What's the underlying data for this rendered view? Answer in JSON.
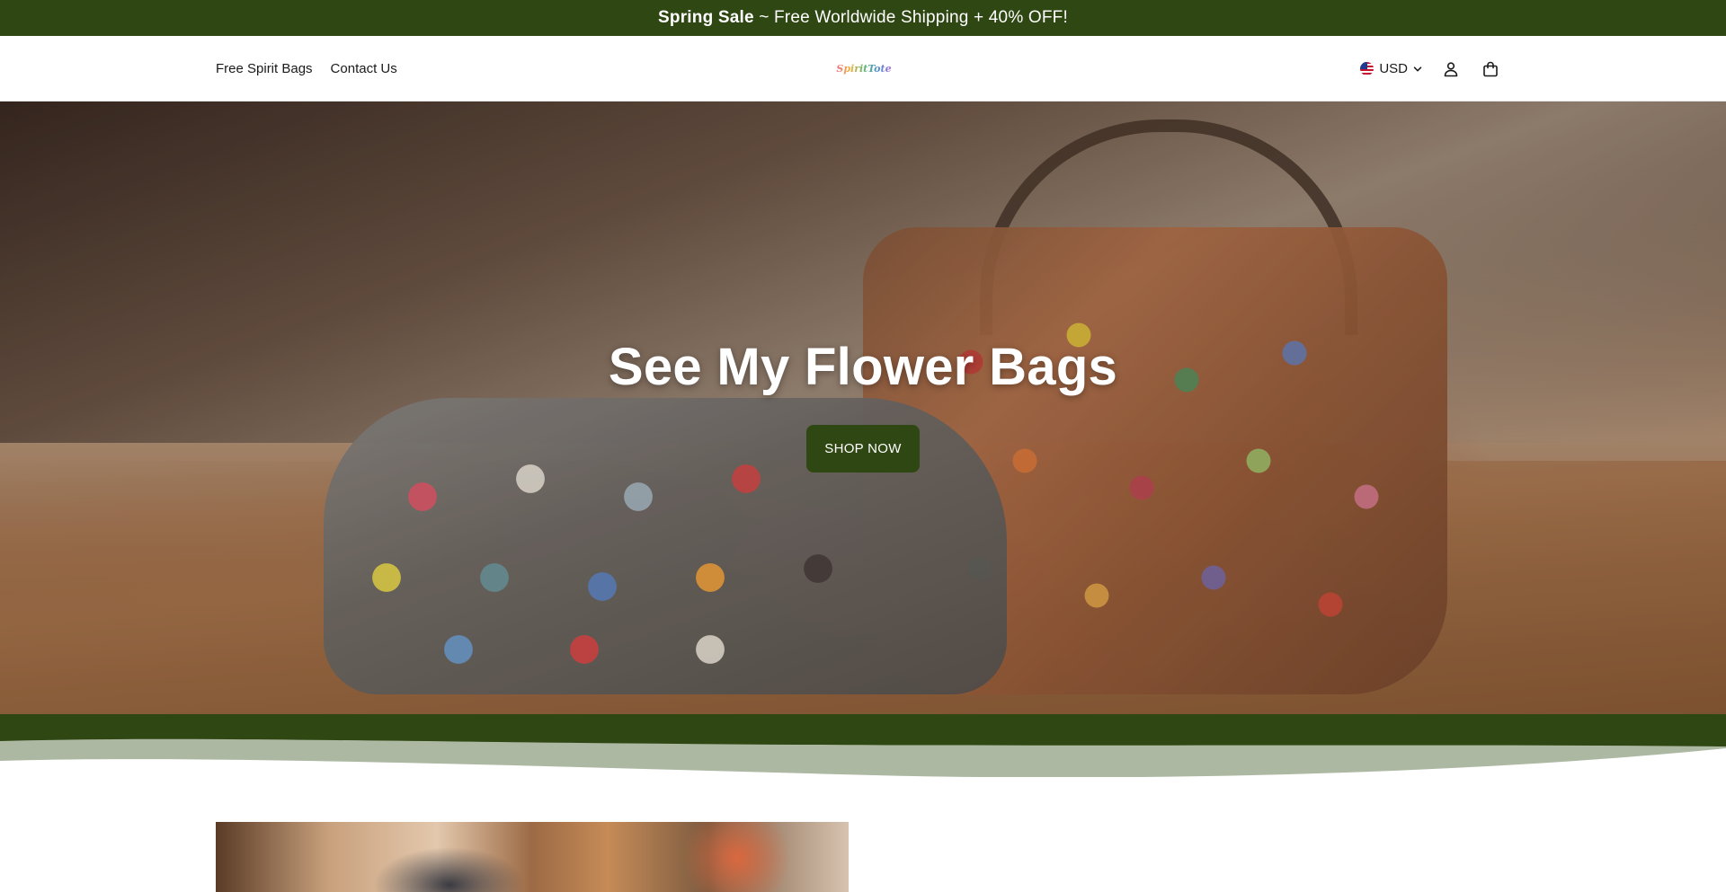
{
  "announcement": {
    "bold": "Spring Sale",
    "rest": " ~ Free Worldwide Shipping + 40% OFF!"
  },
  "header": {
    "nav": [
      {
        "label": "Free Spirit Bags"
      },
      {
        "label": "Contact Us"
      }
    ],
    "logo_text": "SpiritTote",
    "currency": "USD",
    "icons": [
      "account-icon",
      "cart-icon"
    ]
  },
  "hero": {
    "title": "See My Flower Bags",
    "button": "SHOP NOW"
  },
  "colors": {
    "brand_green": "#2f4712",
    "wave_sage": "#adb8a3",
    "white": "#ffffff"
  }
}
